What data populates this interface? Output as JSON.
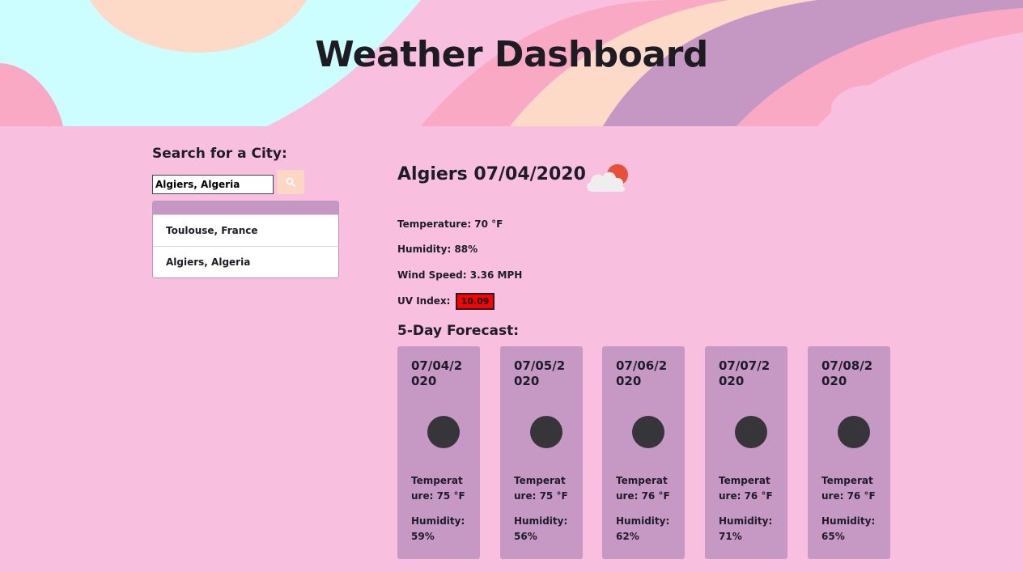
{
  "header": {
    "title": "Weather Dashboard"
  },
  "search": {
    "label": "Search for a City:",
    "value": "Algiers, Algeria",
    "button_icon": "search-icon"
  },
  "history": {
    "items": [
      "Toulouse, France",
      "Algiers, Algeria"
    ]
  },
  "current": {
    "heading": "Algiers 07/04/2020",
    "icon": "partly-cloudy-sun-icon",
    "temperature": "Temperature: 70 °F",
    "humidity": "Humidity: 88%",
    "wind": "Wind Speed: 3.36 MPH",
    "uv_label": "UV Index:",
    "uv_value": "10.09",
    "uv_color": "#ff0000"
  },
  "forecast": {
    "title": "5-Day Forecast:",
    "days": [
      {
        "date": "07/04/2020",
        "temp": "Temperature: 75 °F",
        "humidity": "Humidity: 59%"
      },
      {
        "date": "07/05/2020",
        "temp": "Temperature: 75 °F",
        "humidity": "Humidity: 56%"
      },
      {
        "date": "07/06/2020",
        "temp": "Temperature: 76 °F",
        "humidity": "Humidity: 62%"
      },
      {
        "date": "07/07/2020",
        "temp": "Temperature: 76 °F",
        "humidity": "Humidity: 71%"
      },
      {
        "date": "07/08/2020",
        "temp": "Temperature: 76 °F",
        "humidity": "Humidity: 65%"
      }
    ]
  },
  "colors": {
    "background": "#f8c0de",
    "card": "#c699c4",
    "search_button": "#fdd6c4",
    "header_cyan": "#ccfdff",
    "header_peach": "#fddac7",
    "header_purple": "#c598c3",
    "header_pink": "#f9a9c4"
  }
}
